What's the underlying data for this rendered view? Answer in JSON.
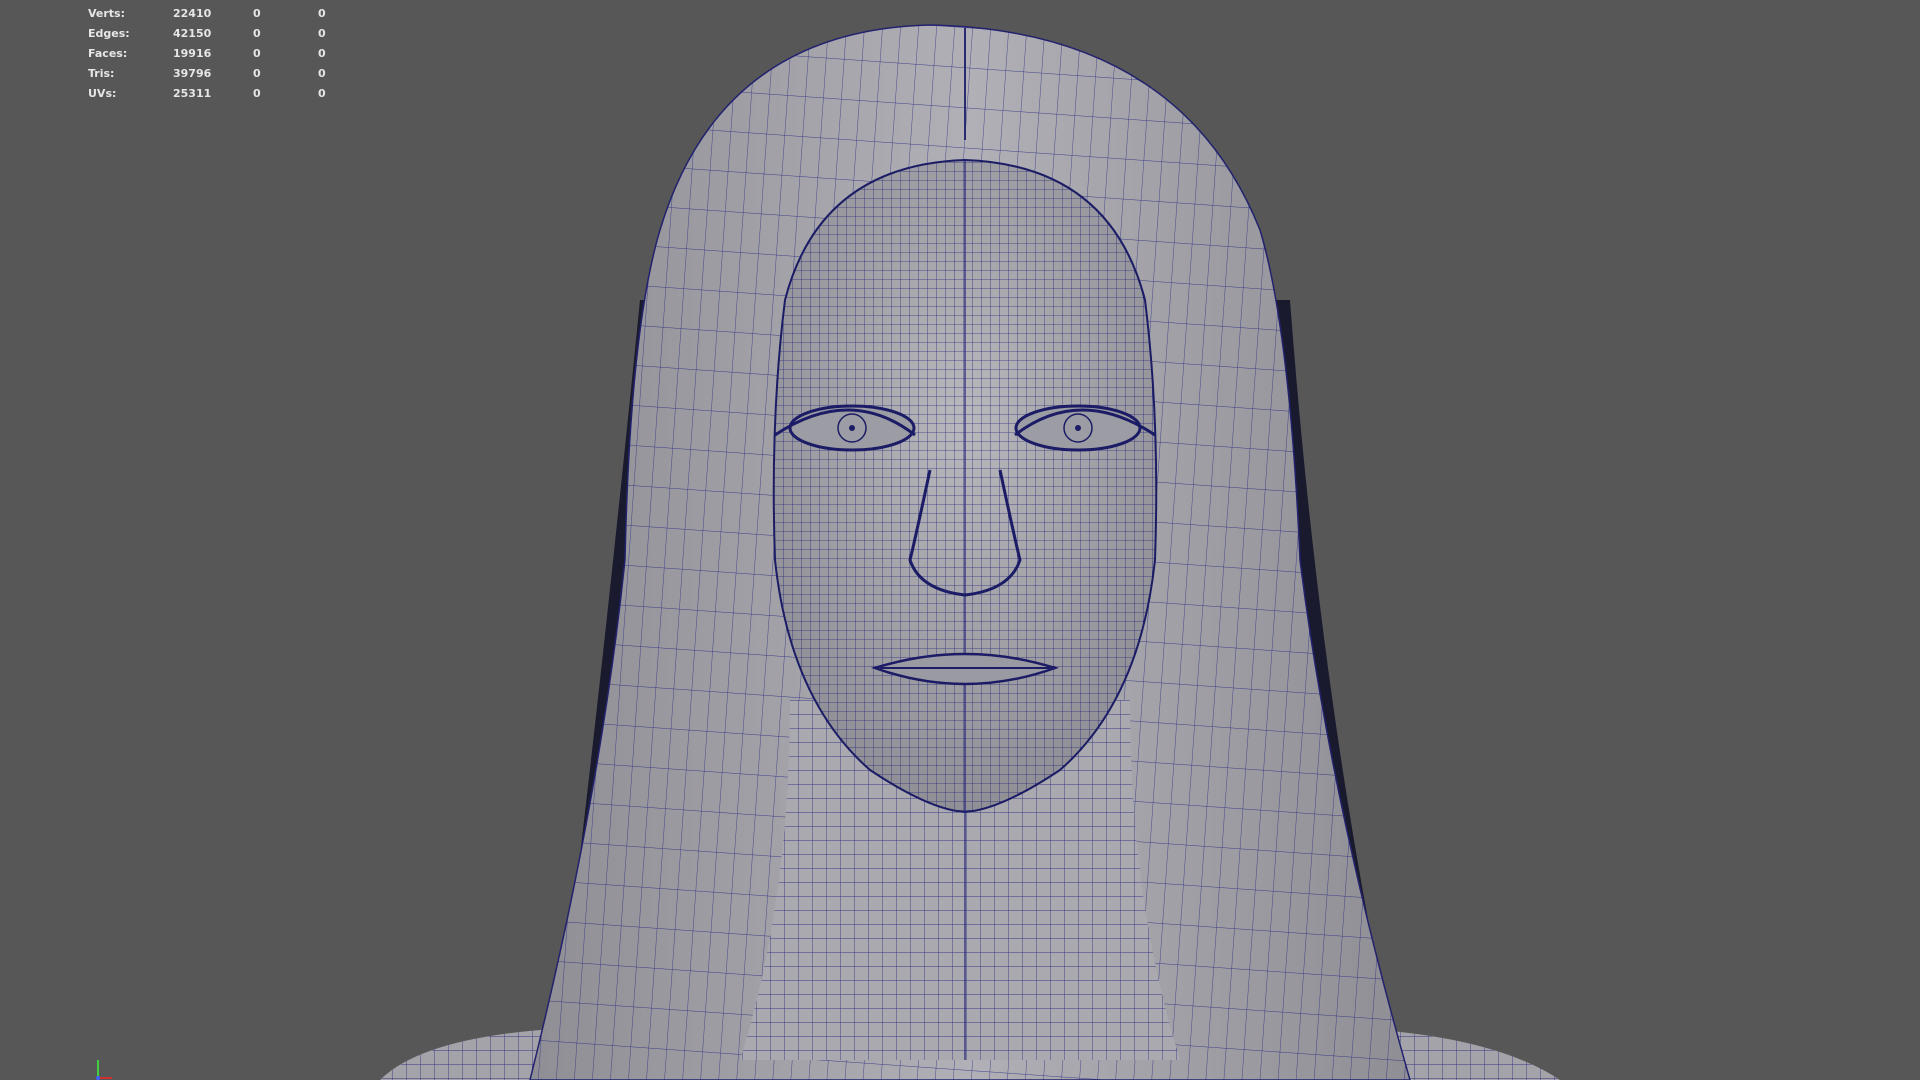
{
  "heads_up_display": {
    "rows": [
      {
        "label": "Verts:",
        "total": "22410",
        "selected": "0",
        "sel_comp": "0"
      },
      {
        "label": "Edges:",
        "total": "42150",
        "selected": "0",
        "sel_comp": "0"
      },
      {
        "label": "Faces:",
        "total": "19916",
        "selected": "0",
        "sel_comp": "0"
      },
      {
        "label": "Tris:",
        "total": "39796",
        "selected": "0",
        "sel_comp": "0"
      },
      {
        "label": "UVs:",
        "total": "25311",
        "selected": "0",
        "sel_comp": "0"
      }
    ]
  },
  "viewport": {
    "background_color": "#575757",
    "mesh_fill_color": "#a8a8ae",
    "wire_color": "#1e1e7a",
    "view_axis_icon": "view-axis-gizmo-icon"
  }
}
